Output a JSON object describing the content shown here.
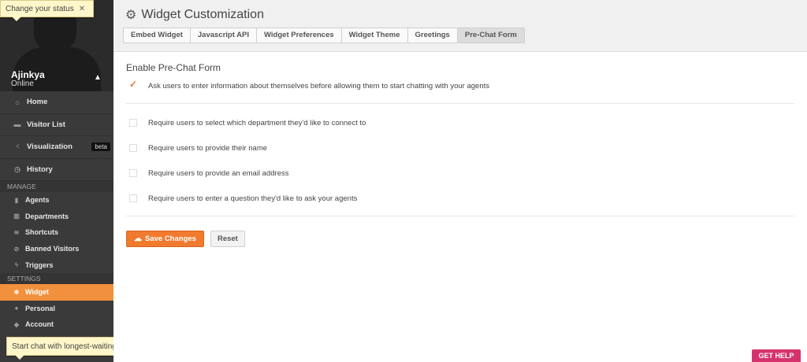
{
  "tooltips": {
    "status": {
      "text": "Change your status",
      "close": "✕"
    },
    "waiting": {
      "text": "Start chat with longest-waiting visitor",
      "close": "✕"
    }
  },
  "profile": {
    "name": "Ajinkya",
    "status": "Online",
    "toggle": "▲"
  },
  "nav": {
    "home": "Home",
    "visitor_list": "Visitor List",
    "visualization": "Visualization",
    "visualization_badge": "beta",
    "history": "History",
    "manage_section": "MANAGE",
    "agents": "Agents",
    "departments": "Departments",
    "shortcuts": "Shortcuts",
    "banned_visitors": "Banned Visitors",
    "triggers": "Triggers",
    "settings_section": "SETTINGS",
    "widget": "Widget",
    "personal": "Personal",
    "account": "Account"
  },
  "header": {
    "title": "Widget Customization",
    "tabs": [
      "Embed Widget",
      "Javascript API",
      "Widget Preferences",
      "Widget Theme",
      "Greetings",
      "Pre-Chat Form"
    ],
    "active_tab": "Pre-Chat Form"
  },
  "form": {
    "section_title": "Enable Pre-Chat Form",
    "enable_label": "Ask users to enter information about themselves before allowing them to start chatting with your agents",
    "enable_checked": true,
    "options": [
      {
        "label": "Require users to select which department they'd like to connect to",
        "checked": false
      },
      {
        "label": "Require users to provide their name",
        "checked": false
      },
      {
        "label": "Require users to provide an email address",
        "checked": false
      },
      {
        "label": "Require users to enter a question they'd like to ask your agents",
        "checked": false
      }
    ],
    "save_label": "Save Changes",
    "reset_label": "Reset"
  },
  "help": {
    "label": "GET HELP"
  },
  "colors": {
    "accent": "#f2913d",
    "sidebar": "#3a3a3a",
    "help": "#d6336c"
  }
}
